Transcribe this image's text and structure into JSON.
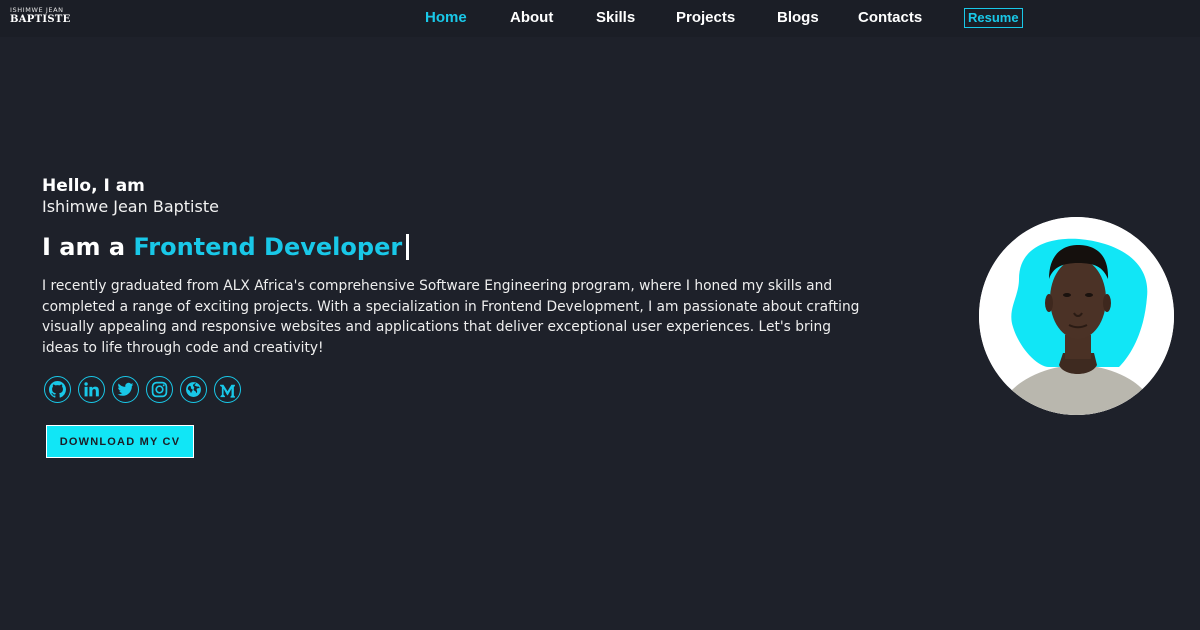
{
  "logo": {
    "line1": "ISHIMWE JEAN",
    "line2": "BAPTISTE"
  },
  "nav": {
    "items": [
      {
        "label": "Home",
        "active": true
      },
      {
        "label": "About",
        "active": false
      },
      {
        "label": "Skills",
        "active": false
      },
      {
        "label": "Projects",
        "active": false
      },
      {
        "label": "Blogs",
        "active": false
      },
      {
        "label": "Contacts",
        "active": false
      }
    ],
    "resume_label": "Resume"
  },
  "hero": {
    "greeting": "Hello, I am",
    "name": "Ishimwe Jean Baptiste",
    "role_prefix": "I am a ",
    "role": "Frontend Developer",
    "bio": "I recently graduated from ALX Africa's comprehensive Software Engineering program, where I honed my skills and completed a range of exciting projects. With a specialization in Frontend Development, I am passionate about crafting visually appealing and responsive websites and applications that deliver exceptional user experiences. Let's bring ideas to life through code and creativity!",
    "cv_button": "DOWNLOAD MY CV"
  },
  "socials": [
    {
      "icon": "github-icon"
    },
    {
      "icon": "linkedin-icon"
    },
    {
      "icon": "twitter-icon"
    },
    {
      "icon": "instagram-icon"
    },
    {
      "icon": "globe-icon"
    },
    {
      "icon": "medium-icon"
    }
  ],
  "colors": {
    "background": "#1e212a",
    "navbar": "#1b1e26",
    "accent": "#19c8e8",
    "button": "#11e6f6",
    "text": "#ffffff"
  }
}
